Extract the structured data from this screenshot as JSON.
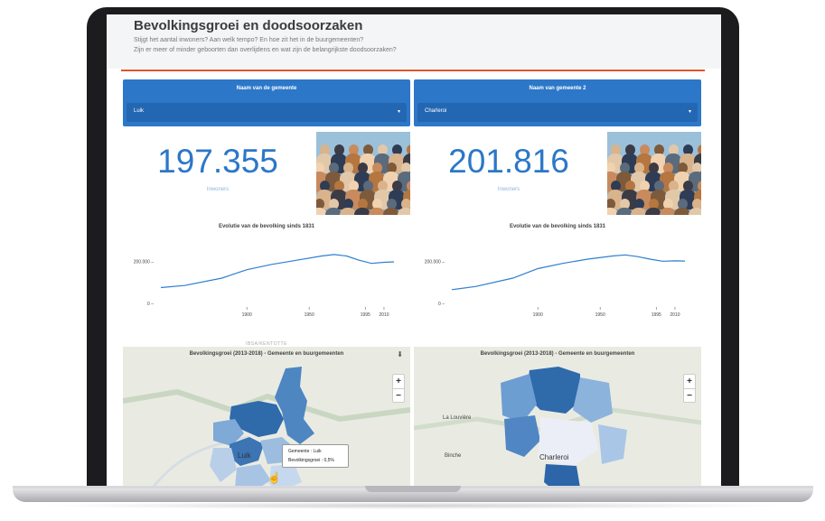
{
  "header": {
    "title": "Bevolkingsgroei en doodsoorzaken",
    "line1": "Stijgt het aantal inwoners? Aan welk tempo? En hoe zit het in de buurgemeenten?",
    "line2": "Zijn er meer of minder geboorten dan overlijdens en wat zijn de belangrijkste doodsoorzaken?"
  },
  "panels": [
    {
      "select_label": "Naam van de gemeente",
      "select_value": "Luik",
      "population": "197.355",
      "population_label": "Inwoners",
      "chart_title": "Evolutie van de bevolking sinds 1831",
      "map_title": "Bevolkingsgroei (2013-2018) - Gemeente en buurgemeenten",
      "map_label": "Luik",
      "watermark": "IBSA/KENTOTTE",
      "tooltip": {
        "line1": "Gemeente : Luik",
        "line2": "Bevolkingsgroei : 0,5%"
      }
    },
    {
      "select_label": "Naam van gemeente 2",
      "select_value": "Charleroi",
      "population": "201.816",
      "population_label": "Inwoners",
      "chart_title": "Evolutie van de bevolking sinds 1831",
      "map_title": "Bevolkingsgroei (2013-2018) - Gemeente en buurgemeenten",
      "map_label": "Charleroi",
      "places": [
        "La Louvière",
        "Binche"
      ]
    }
  ],
  "map_controls": {
    "zoom_in": "+",
    "zoom_out": "−",
    "download_icon": "download-icon"
  },
  "chart_data": [
    {
      "type": "line",
      "title": "Evolutie van de bevolking sinds 1831",
      "x_ticks": [
        "1900",
        "1950",
        "1995",
        "2010"
      ],
      "y_ticks": [
        "200.000",
        "0"
      ],
      "ylim": [
        0,
        300000
      ],
      "xlim": [
        1831,
        2018
      ],
      "series": [
        {
          "x": [
            1831,
            1850,
            1880,
            1900,
            1920,
            1940,
            1960,
            1970,
            1980,
            1990,
            2000,
            2010,
            2018
          ],
          "values": [
            75000,
            85000,
            120000,
            160000,
            185000,
            205000,
            225000,
            232000,
            225000,
            205000,
            190000,
            195000,
            197000
          ]
        }
      ]
    },
    {
      "type": "line",
      "title": "Evolutie van de bevolking sinds 1831",
      "x_ticks": [
        "1900",
        "1950",
        "1995",
        "2010"
      ],
      "y_ticks": [
        "200.000",
        "0"
      ],
      "ylim": [
        0,
        300000
      ],
      "xlim": [
        1831,
        2018
      ],
      "series": [
        {
          "x": [
            1831,
            1850,
            1880,
            1900,
            1920,
            1940,
            1960,
            1970,
            1980,
            1990,
            2000,
            2010,
            2018
          ],
          "values": [
            65000,
            80000,
            120000,
            165000,
            190000,
            210000,
            225000,
            230000,
            222000,
            210000,
            200000,
            202000,
            201000
          ]
        }
      ]
    }
  ],
  "colors": {
    "accent": "#2c77c8",
    "rule": "#e0532b",
    "line": "#2e7fd0"
  }
}
